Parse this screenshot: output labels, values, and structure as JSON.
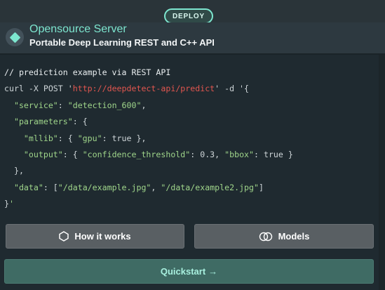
{
  "badge": {
    "label": "DEPLOY"
  },
  "header": {
    "title": "Opensource Server",
    "subtitle": "Portable Deep Learning REST and C++ API"
  },
  "code": {
    "comment": "// prediction example via REST API",
    "cmd_prefix": "curl -X POST '",
    "url": "http://deepdetect-api/predict",
    "cmd_suffix": "' -d '{",
    "line2_key": "  \"service\"",
    "line2_sep": ": ",
    "line2_val": "\"detection_600\"",
    "line2_end": ",",
    "line3_key": "  \"parameters\"",
    "line3_end": ": {",
    "line4_key": "    \"mllib\"",
    "line4_mid": ": { ",
    "line4_k2": "\"gpu\"",
    "line4_rest": ": true },",
    "line5_key": "    \"output\"",
    "line5_mid": ": { ",
    "line5_k2": "\"confidence_threshold\"",
    "line5_mid2": ": 0.3, ",
    "line5_k3": "\"bbox\"",
    "line5_rest": ": true }",
    "line6": "  },",
    "line7_key": "  \"data\"",
    "line7_mid": ": [",
    "line7_v1": "\"/data/example.jpg\"",
    "line7_sep": ", ",
    "line7_v2": "\"/data/example2.jpg\"",
    "line7_end": "]",
    "line8_a": "}",
    "line8_b": "'"
  },
  "buttons": {
    "how_it_works": "How it works",
    "models": "Models",
    "quickstart": "Quickstart",
    "quickstart_arrow": "→"
  },
  "colors": {
    "accent": "#7de6cf",
    "url": "#e2564f",
    "string": "#9fd58a"
  },
  "icons": {
    "logo": "diamond-icon",
    "how_it_works": "hexagon-icon",
    "models": "double-circle-icon",
    "quickstart": "arrow-right-icon"
  }
}
